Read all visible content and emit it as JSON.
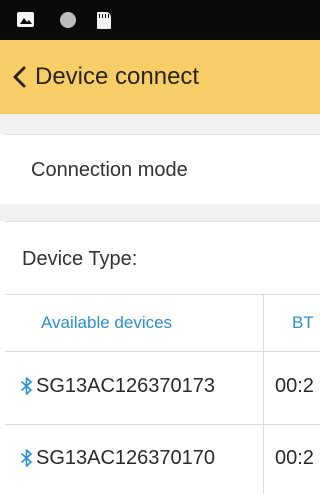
{
  "status_bar": {
    "icons": [
      "image-icon",
      "circle-icon",
      "sd-card-icon"
    ]
  },
  "app_bar": {
    "title": "Device connect",
    "background": "#f7cd68",
    "back_icon": "chevron-left-icon"
  },
  "connection": {
    "label": "Connection mode"
  },
  "device_type": {
    "label": "Device Type:"
  },
  "devices_table": {
    "columns": [
      "Available devices",
      "BT"
    ],
    "header_color": "#2c8fd6",
    "rows": [
      {
        "name": "SG13AC126370173",
        "bt": "00:2",
        "icon": "bluetooth-icon"
      },
      {
        "name": "SG13AC126370170",
        "bt": "00:2",
        "icon": "bluetooth-icon"
      }
    ]
  }
}
